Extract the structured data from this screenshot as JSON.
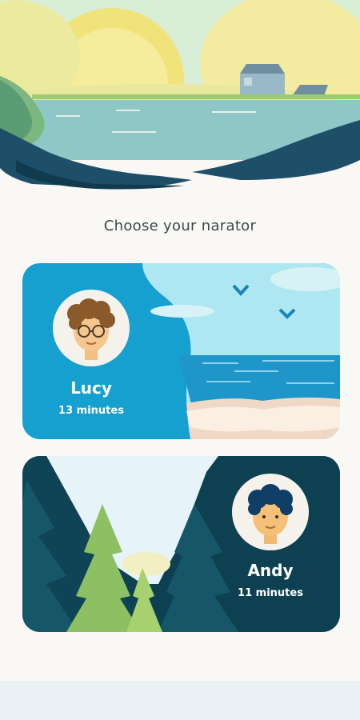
{
  "heading": "Choose your narator",
  "narrators": [
    {
      "name": "Lucy",
      "duration": "13 minutes"
    },
    {
      "name": "Andy",
      "duration": "11 minutes"
    }
  ],
  "colors": {
    "lucy_card": "#15a0d0",
    "andy_card": "#0d4152",
    "background": "#f9f8f5"
  }
}
